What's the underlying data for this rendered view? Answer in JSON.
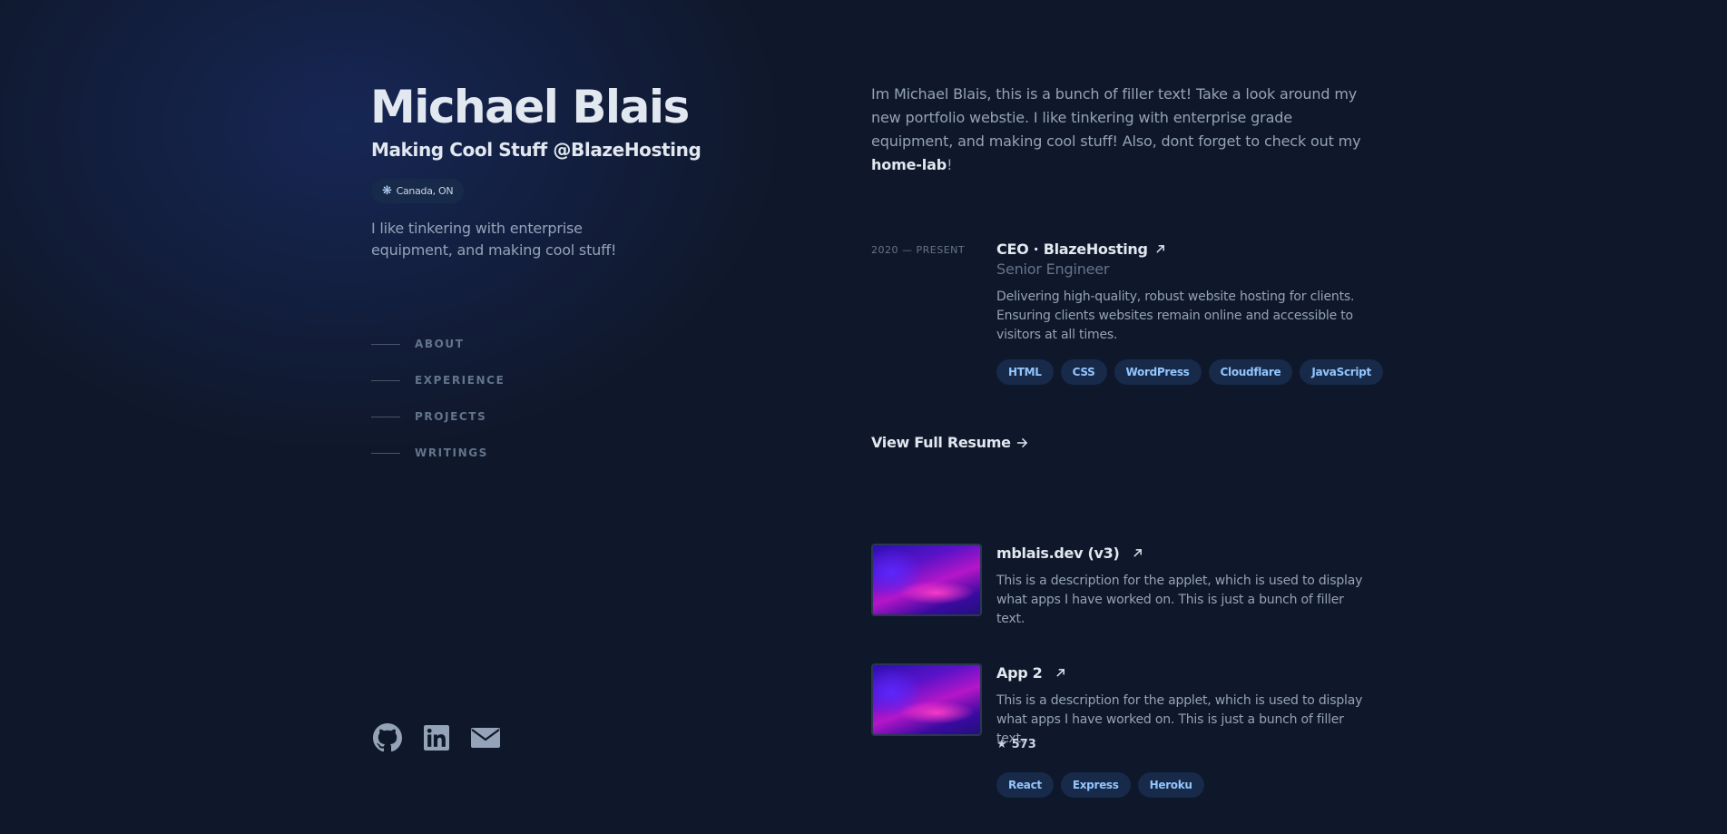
{
  "header": {
    "name": "Michael Blais",
    "tagline": "Making Cool Stuff @BlazeHosting",
    "location": "Canada, ON",
    "intro": "I like tinkering with enterprise equipment, and making cool stuff!"
  },
  "nav": {
    "items": [
      {
        "label": "ABOUT"
      },
      {
        "label": "EXPERIENCE"
      },
      {
        "label": "PROJECTS"
      },
      {
        "label": "WRITINGS"
      }
    ]
  },
  "socials": {
    "icons": [
      "github-icon",
      "linkedin-icon",
      "mail-icon"
    ]
  },
  "about": {
    "text_before": "Im Michael Blais, this is a bunch of filler text! Take a look around my new portfolio webstie. I like tinkering with enterprise grade equipment, and making cool stuff! Also, dont forget to check out my ",
    "link_text": "home-lab",
    "text_after": "!"
  },
  "experience": {
    "period": "2020 — PRESENT",
    "title": "CEO · BlazeHosting",
    "subtitle": "Senior Engineer",
    "description": "Delivering high-quality, robust website hosting for clients. Ensuring clients websites remain online and accessible to visitors at all times.",
    "tags": [
      "HTML",
      "CSS",
      "WordPress",
      "Cloudflare",
      "JavaScript"
    ],
    "resume_link": "View Full Resume"
  },
  "projects": [
    {
      "title": "mblais.dev (v3)",
      "description": "This is a description for the applet, which is used to display what apps I have worked on. This is just a bunch of filler text."
    },
    {
      "title": "App 2",
      "description": "This is a description for the applet, which is used to display what apps I have worked on. This is just a bunch of filler text.",
      "stars": "573",
      "tags": [
        "React",
        "Express",
        "Heroku"
      ]
    }
  ],
  "colors": {
    "background": "#0f172a",
    "heading": "#e2e8f0",
    "body_text": "#94a3b8",
    "muted": "#64748b",
    "tag_bg": "#172a4a",
    "tag_text": "#93c5fd"
  }
}
